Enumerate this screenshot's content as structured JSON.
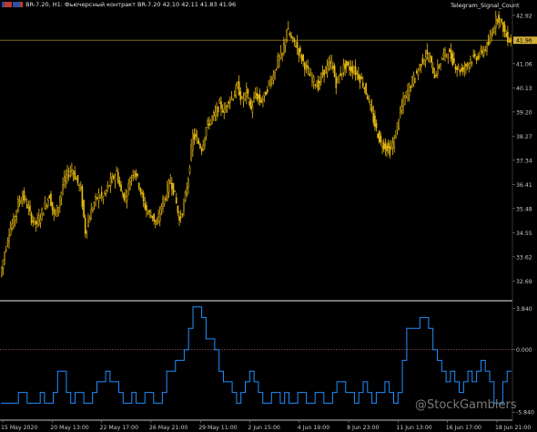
{
  "header": {
    "symbol_info": "BR-7.20, H1: Фьючерсный контракт BR-7.20  42.10 42.11 41.83 41.96"
  },
  "indicator_label": "Telegram_Signal_Count",
  "watermark": "@StockGamblers",
  "colors": {
    "background": "#000000",
    "candles": "#e8b90f",
    "price_line": "#8a7a2a",
    "indicator": "#1e90ff",
    "zero_line": "#8b4a4a",
    "axis_text": "#c8c8c8",
    "price_tag": "#d4af37"
  },
  "chart_data": [
    {
      "type": "candlestick",
      "title": "",
      "instrument": "BR-7.20",
      "timeframe": "H1",
      "last_price": 41.96,
      "ohlc_last": {
        "open": 42.1,
        "high": 42.11,
        "low": 41.83,
        "close": 41.96
      },
      "y_ticks": [
        "42.92",
        "41.96",
        "41.06",
        "40.13",
        "39.20",
        "38.27",
        "37.34",
        "36.41",
        "35.48",
        "34.55",
        "33.62",
        "32.69"
      ],
      "x_ticks": [
        "15 May 2020",
        "20 May 13:00",
        "22 May 17:00",
        "26 May 21:00",
        "29 May 11:00",
        "2 Jun 15:00",
        "4 Jun 19:00",
        "8 Jun 23:00",
        "11 Jun 13:00",
        "16 Jun 17:00",
        "18 Jun 21:00"
      ],
      "ylim": [
        32.0,
        43.3
      ],
      "close_path": [
        32.9,
        33.8,
        34.6,
        35.0,
        35.7,
        36.0,
        35.6,
        35.1,
        34.9,
        35.2,
        35.6,
        36.0,
        35.2,
        35.6,
        36.4,
        36.8,
        37.0,
        36.6,
        36.2,
        34.6,
        35.2,
        35.7,
        36.0,
        35.9,
        36.3,
        36.6,
        36.9,
        36.1,
        35.9,
        36.6,
        37.0,
        36.4,
        35.7,
        35.3,
        35.2,
        34.8,
        35.6,
        36.0,
        36.6,
        36.0,
        35.0,
        35.6,
        36.7,
        38.3,
        38.1,
        37.8,
        38.6,
        38.9,
        39.1,
        39.5,
        39.2,
        39.7,
        39.8,
        40.2,
        39.6,
        40.0,
        39.3,
        39.9,
        39.6,
        39.8,
        40.3,
        40.6,
        41.2,
        41.4,
        42.4,
        42.0,
        41.8,
        41.4,
        41.0,
        40.6,
        40.4,
        40.2,
        40.7,
        40.9,
        41.1,
        40.3,
        40.7,
        41.0,
        40.9,
        40.8,
        40.6,
        40.3,
        39.8,
        39.1,
        38.5,
        38.0,
        37.9,
        37.7,
        38.1,
        39.0,
        39.6,
        40.0,
        40.4,
        40.7,
        41.1,
        41.4,
        41.2,
        40.6,
        41.0,
        41.4,
        41.5,
        41.2,
        40.9,
        40.8,
        41.0,
        41.2,
        41.3,
        41.4,
        41.6,
        41.8,
        42.4,
        42.9,
        42.6,
        42.1,
        41.96
      ]
    },
    {
      "type": "step-line",
      "title": "",
      "series_name": "Telegram_Signal_Count",
      "y_ticks": [
        "3.840",
        "0.000",
        "-5.840"
      ],
      "ylim": [
        -6.5,
        4.4
      ],
      "values": [
        -5,
        -5,
        -5,
        -5,
        -4,
        -4,
        -5,
        -5,
        -5,
        -4,
        -5,
        -5,
        -4,
        -2,
        -2,
        -4,
        -5,
        -4,
        -4,
        -5,
        -5,
        -4,
        -3,
        -3,
        -2,
        -3,
        -3,
        -4,
        -5,
        -5,
        -4,
        -5,
        -5,
        -4,
        -4,
        -5,
        -5,
        -4,
        -2,
        -2,
        -1,
        -1,
        0,
        2,
        4,
        4,
        3,
        1,
        1,
        0,
        -2,
        -3,
        -3,
        -4,
        -5,
        -4,
        -3,
        -2,
        -3,
        -4,
        -5,
        -5,
        -4,
        -4,
        -5,
        -4,
        -5,
        -5,
        -4,
        -4,
        -5,
        -5,
        -4,
        -4,
        -5,
        -5,
        -4,
        -3,
        -3,
        -4,
        -4,
        -5,
        -4,
        -3,
        -4,
        -5,
        -4,
        -4,
        -3,
        -4,
        -5,
        -4,
        -1,
        2,
        2,
        2,
        3,
        3,
        2,
        0,
        -1,
        -2,
        -3,
        -2,
        -3,
        -4,
        -3,
        -2,
        -3,
        -2,
        -1,
        -2,
        -3,
        -5,
        -5,
        -3,
        -2
      ]
    }
  ]
}
